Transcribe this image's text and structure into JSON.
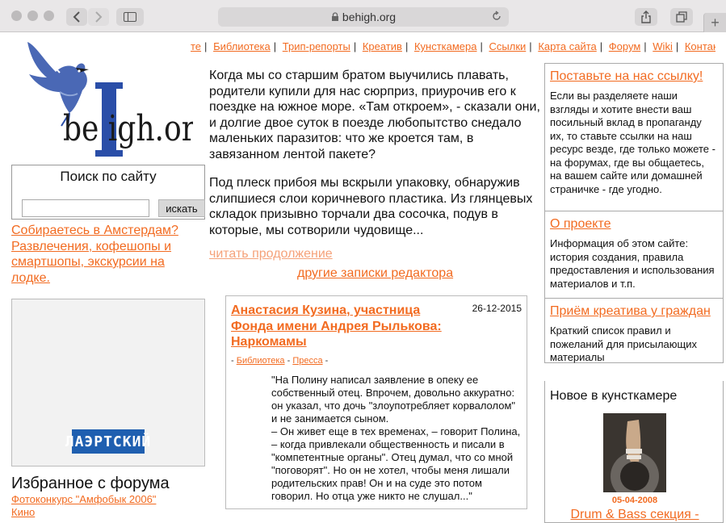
{
  "browser": {
    "url": "behigh.org"
  },
  "logo": {
    "text": "beHigh.org"
  },
  "topmenu": {
    "items": [
      "те",
      "Библиотека",
      "Трип-репорты",
      "Креатив",
      "Кунсткамера",
      "Ссылки",
      "Карта сайта",
      "Форум",
      "Wiki",
      "Контакт"
    ]
  },
  "search": {
    "title": "Поиск по сайту",
    "button": "искать",
    "value": ""
  },
  "amsterdam": {
    "link": "Собираетесь в Амстердам? Развлечения, кофешопы и смартшопы, экскурсии на лодке."
  },
  "ad": {
    "label": "ЛАЭРТСКИЙ"
  },
  "favorites": {
    "title": "Избранное с форума",
    "items": [
      "Фотоконкурс \"Амфобык 2006\"",
      "Кино"
    ]
  },
  "main": {
    "para1": "Когда мы со старшим братом выучились плавать, родители купили для нас сюрприз, приурочив его к поездке на южное море. «Там откроем», - сказали они, и долгие двое суток в поезде любопытство снедало маленьких паразитов: что же кроется там, в завязанном лентой пакете?",
    "para2": "Под плеск прибоя мы вскрыли упаковку, обнаружив слипшиеся слои коричневого пластика. Из глянцевых складок призывно торчали два сосочка, подув в которые, мы сотворили чудовище...",
    "read_more": "читать продолжение",
    "other_notes": "другие записки редактора"
  },
  "article": {
    "title": "Анастасия Кузина, участница Фонда имени Андрея Рылькова: Наркомамы",
    "date": "26-12-2015",
    "tag_prefix": "- ",
    "tag1": "Библиотека",
    "tag_sep": " - ",
    "tag2": "Пресса",
    "tag_suffix": " -",
    "quote": "\"На Полину написал заявление в опеку ее собственный отец. Впрочем, довольно аккуратно: он указал, что дочь \"злоупотребляет корвалолом\" и не занимается сыном.\n– Он живет еще в тех временах, – говорит Полина, – когда привлекали общественность и писали в \"компетентные органы\". Отец думал, что со мной \"поговорят\". Но он не хотел, чтобы меня лишали родительских прав! Он и на суде это потом говорил. Но отца уже никто не слушал...\""
  },
  "right": {
    "box1_title": "Поставьте на нас ссылку!",
    "box1_text": "Если вы разделяете наши взгляды и хотите внести ваш посильный вклад в пропаганду их, то ставьте ссылки на наш ресурс везде, где только можете - на форумах, где вы общаетесь, на вашем сайте или домашней страничке - где угодно.",
    "box2_title": "О проекте",
    "box2_text": "Информация об этом сайте: история создания, правила предоставления и использования материалов и т.п.",
    "box3_title": "Приём креатива у граждан",
    "box3_text": "Краткий список правил и пожеланий для присылающих материалы",
    "kunst_title": "Новое в кунсткамере",
    "kunst_date": "05-04-2008",
    "kunst_link": "Drum & Bass секция -"
  },
  "colors": {
    "link": "#f26b21",
    "link_faded": "#f5a27a",
    "logo_blue": "#2a4ea8",
    "ad_blue": "#1f5fb0"
  }
}
